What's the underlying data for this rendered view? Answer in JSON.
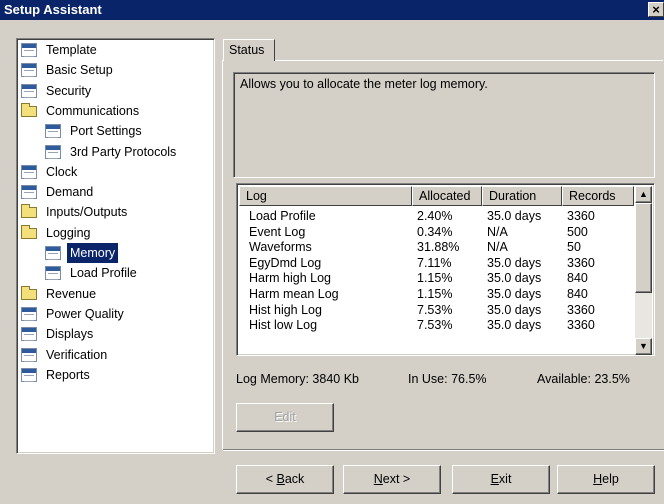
{
  "window": {
    "title": "Setup Assistant",
    "close_label": "×"
  },
  "tree": {
    "items": [
      {
        "label": "Template",
        "icon": "document-icon",
        "level": 0,
        "selected": false
      },
      {
        "label": "Basic Setup",
        "icon": "document-icon",
        "level": 0,
        "selected": false
      },
      {
        "label": "Security",
        "icon": "document-icon",
        "level": 0,
        "selected": false
      },
      {
        "label": "Communications",
        "icon": "folder-icon",
        "level": 0,
        "selected": false
      },
      {
        "label": "Port Settings",
        "icon": "document-icon",
        "level": 1,
        "selected": false
      },
      {
        "label": "3rd Party Protocols",
        "icon": "document-icon",
        "level": 1,
        "selected": false
      },
      {
        "label": "Clock",
        "icon": "document-icon",
        "level": 0,
        "selected": false
      },
      {
        "label": "Demand",
        "icon": "document-icon",
        "level": 0,
        "selected": false
      },
      {
        "label": "Inputs/Outputs",
        "icon": "folder-icon",
        "level": 0,
        "selected": false
      },
      {
        "label": "Logging",
        "icon": "folder-icon",
        "level": 0,
        "selected": false
      },
      {
        "label": "Memory",
        "icon": "document-icon",
        "level": 1,
        "selected": true
      },
      {
        "label": "Load Profile",
        "icon": "document-icon",
        "level": 1,
        "selected": false
      },
      {
        "label": "Revenue",
        "icon": "folder-icon",
        "level": 0,
        "selected": false
      },
      {
        "label": "Power Quality",
        "icon": "document-icon",
        "level": 0,
        "selected": false
      },
      {
        "label": "Displays",
        "icon": "document-icon",
        "level": 0,
        "selected": false
      },
      {
        "label": "Verification",
        "icon": "document-icon",
        "level": 0,
        "selected": false
      },
      {
        "label": "Reports",
        "icon": "document-icon",
        "level": 0,
        "selected": false
      }
    ]
  },
  "tabs": [
    {
      "label": "Status",
      "active": true
    }
  ],
  "description": "Allows you to allocate the meter log memory.",
  "log_table": {
    "columns": [
      "Log",
      "Allocated",
      "Duration",
      "Records"
    ],
    "rows": [
      [
        "Load Profile",
        "2.40%",
        "35.0 days",
        "3360"
      ],
      [
        "Event Log",
        "0.34%",
        "N/A",
        "500"
      ],
      [
        "Waveforms",
        "31.88%",
        "N/A",
        "50"
      ],
      [
        "EgyDmd Log",
        "7.11%",
        "35.0 days",
        "3360"
      ],
      [
        "Harm high Log",
        "1.15%",
        "35.0 days",
        "840"
      ],
      [
        "Harm mean Log",
        "1.15%",
        "35.0 days",
        "840"
      ],
      [
        "Hist high Log",
        "7.53%",
        "35.0 days",
        "3360"
      ],
      [
        "Hist low Log",
        "7.53%",
        "35.0 days",
        "3360"
      ]
    ]
  },
  "memory_info": {
    "log_memory": "Log Memory:  3840 Kb",
    "in_use": "In Use:  76.5%",
    "available": "Available:  23.5%"
  },
  "buttons": {
    "edit": "Edit",
    "back_pre": "< ",
    "back_key": "B",
    "back_post": "ack",
    "next_key": "N",
    "next_post": "ext >",
    "exit_key": "E",
    "exit_post": "xit",
    "help_key": "H",
    "help_post": "elp"
  }
}
